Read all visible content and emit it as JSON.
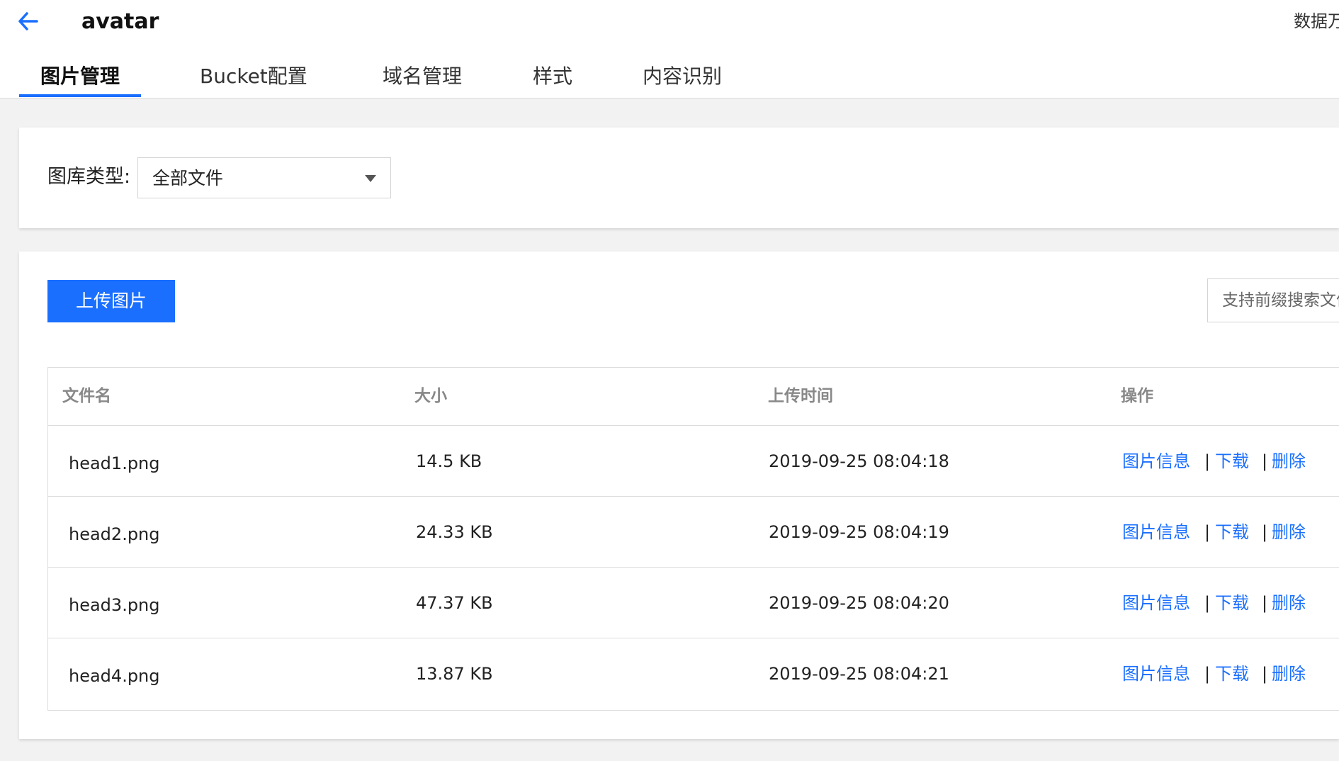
{
  "header": {
    "title": "avatar",
    "right_link": "数据万象"
  },
  "tabs": [
    {
      "label": "图片管理",
      "active": true
    },
    {
      "label": "Bucket配置",
      "active": false
    },
    {
      "label": "域名管理",
      "active": false
    },
    {
      "label": "样式",
      "active": false
    },
    {
      "label": "内容识别",
      "active": false
    }
  ],
  "filter": {
    "label": "图库类型:",
    "selected": "全部文件"
  },
  "toolbar": {
    "upload_label": "上传图片",
    "search_placeholder": "支持前缀搜索文件名"
  },
  "table": {
    "columns": [
      "文件名",
      "大小",
      "上传时间",
      "操作"
    ],
    "rows": [
      {
        "name": "head1.png",
        "size": "14.5 KB",
        "time": "2019-09-25 08:04:18"
      },
      {
        "name": "head2.png",
        "size": "24.33 KB",
        "time": "2019-09-25 08:04:19"
      },
      {
        "name": "head3.png",
        "size": "47.37 KB",
        "time": "2019-09-25 08:04:20"
      },
      {
        "name": "head4.png",
        "size": "13.87 KB",
        "time": "2019-09-25 08:04:21"
      }
    ],
    "actions": {
      "info": "图片信息",
      "download": "下载",
      "delete": "删除",
      "separator": "|"
    }
  },
  "colors": {
    "accent": "#1a6fff",
    "background": "#f2f2f2"
  },
  "icons": {
    "back": "arrow-left-icon",
    "select": "caret-down-icon"
  }
}
